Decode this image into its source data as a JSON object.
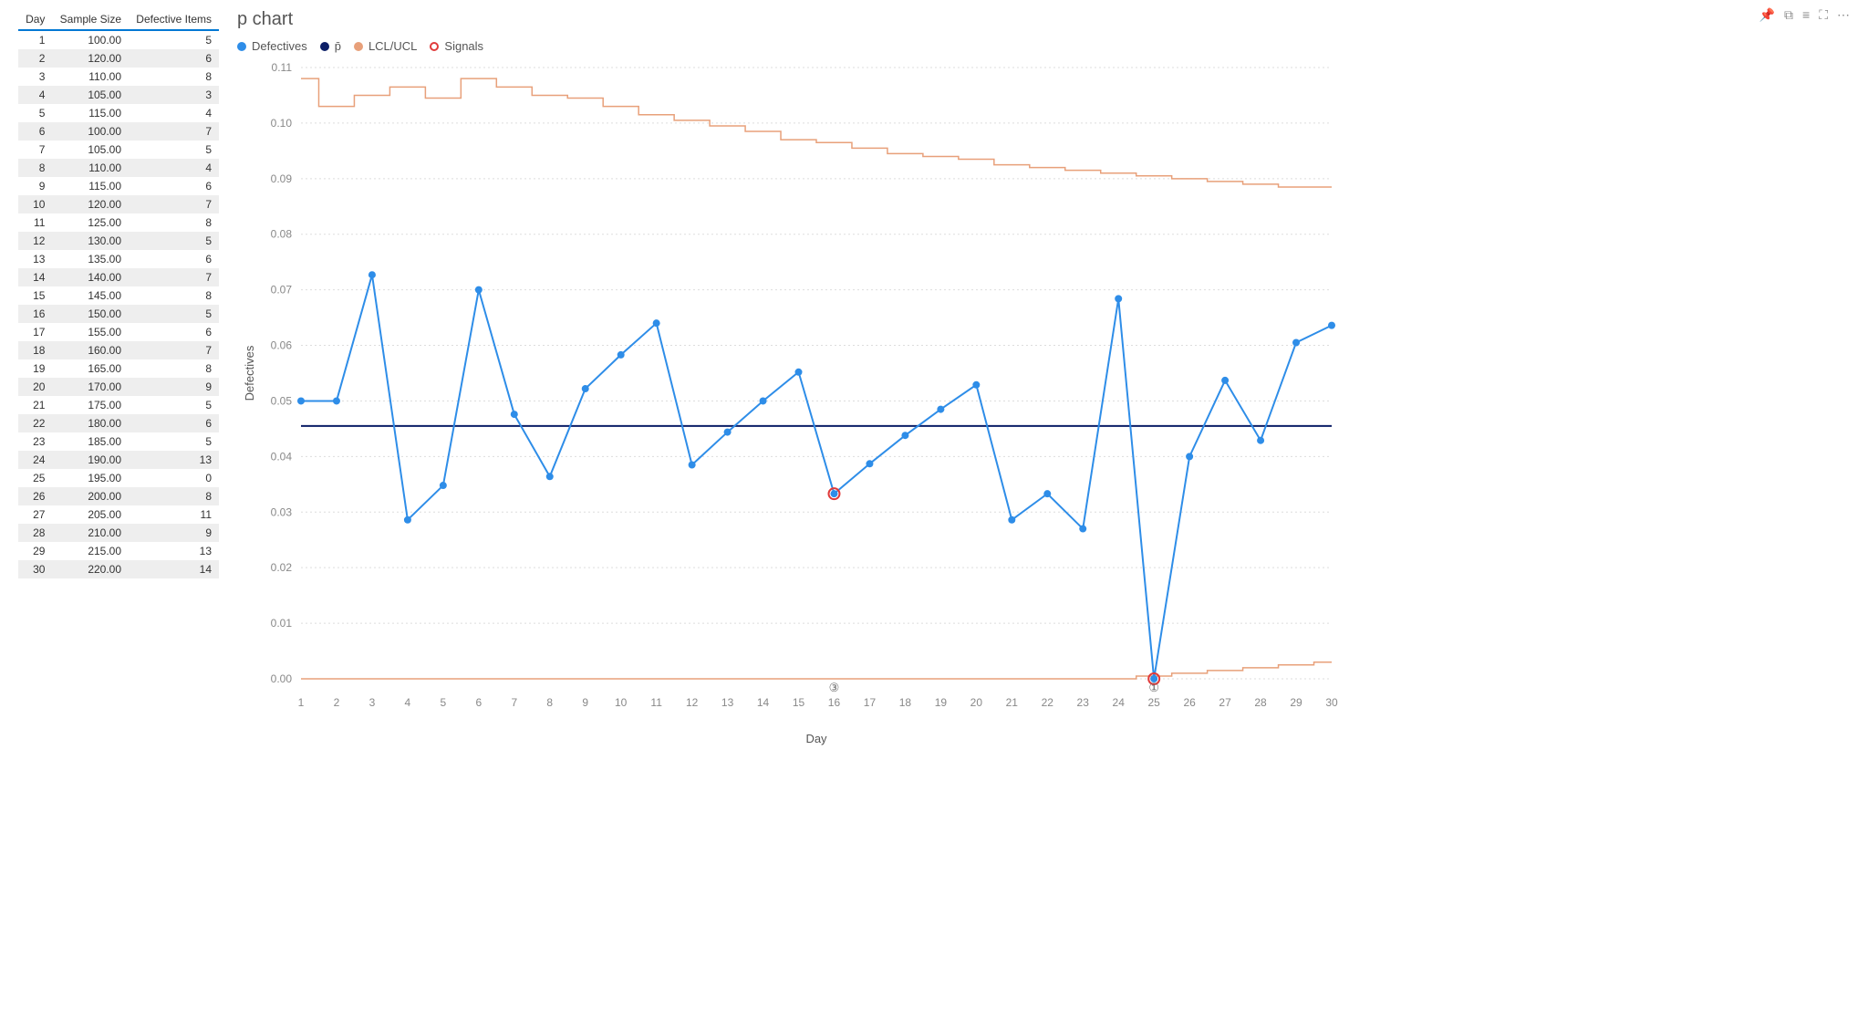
{
  "toolbar": {
    "pin": "📌",
    "copy": "⧉",
    "filter": "≡",
    "focus": "⛶",
    "more": "⋯"
  },
  "table": {
    "headers": [
      "Day",
      "Sample Size",
      "Defective Items"
    ],
    "rows": [
      {
        "day": 1,
        "size": "100.00",
        "def": 5
      },
      {
        "day": 2,
        "size": "120.00",
        "def": 6
      },
      {
        "day": 3,
        "size": "110.00",
        "def": 8
      },
      {
        "day": 4,
        "size": "105.00",
        "def": 3
      },
      {
        "day": 5,
        "size": "115.00",
        "def": 4
      },
      {
        "day": 6,
        "size": "100.00",
        "def": 7
      },
      {
        "day": 7,
        "size": "105.00",
        "def": 5
      },
      {
        "day": 8,
        "size": "110.00",
        "def": 4
      },
      {
        "day": 9,
        "size": "115.00",
        "def": 6
      },
      {
        "day": 10,
        "size": "120.00",
        "def": 7
      },
      {
        "day": 11,
        "size": "125.00",
        "def": 8
      },
      {
        "day": 12,
        "size": "130.00",
        "def": 5
      },
      {
        "day": 13,
        "size": "135.00",
        "def": 6
      },
      {
        "day": 14,
        "size": "140.00",
        "def": 7
      },
      {
        "day": 15,
        "size": "145.00",
        "def": 8
      },
      {
        "day": 16,
        "size": "150.00",
        "def": 5
      },
      {
        "day": 17,
        "size": "155.00",
        "def": 6
      },
      {
        "day": 18,
        "size": "160.00",
        "def": 7
      },
      {
        "day": 19,
        "size": "165.00",
        "def": 8
      },
      {
        "day": 20,
        "size": "170.00",
        "def": 9
      },
      {
        "day": 21,
        "size": "175.00",
        "def": 5
      },
      {
        "day": 22,
        "size": "180.00",
        "def": 6
      },
      {
        "day": 23,
        "size": "185.00",
        "def": 5
      },
      {
        "day": 24,
        "size": "190.00",
        "def": 13
      },
      {
        "day": 25,
        "size": "195.00",
        "def": 0
      },
      {
        "day": 26,
        "size": "200.00",
        "def": 8
      },
      {
        "day": 27,
        "size": "205.00",
        "def": 11
      },
      {
        "day": 28,
        "size": "210.00",
        "def": 9
      },
      {
        "day": 29,
        "size": "215.00",
        "def": 13
      },
      {
        "day": 30,
        "size": "220.00",
        "def": 14
      }
    ]
  },
  "chart_data": {
    "type": "line",
    "title": "p chart",
    "xlabel": "Day",
    "ylabel": "Defectives",
    "ylim": [
      0,
      0.11
    ],
    "yticks": [
      0.0,
      0.01,
      0.02,
      0.03,
      0.04,
      0.05,
      0.06,
      0.07,
      0.08,
      0.09,
      0.1,
      0.11
    ],
    "x": [
      1,
      2,
      3,
      4,
      5,
      6,
      7,
      8,
      9,
      10,
      11,
      12,
      13,
      14,
      15,
      16,
      17,
      18,
      19,
      20,
      21,
      22,
      23,
      24,
      25,
      26,
      27,
      28,
      29,
      30
    ],
    "legend": [
      {
        "name": "Defectives",
        "color": "#2E8DE8",
        "type": "dot"
      },
      {
        "name": "p̄",
        "color": "#0B1E66",
        "type": "dot"
      },
      {
        "name": "LCL/UCL",
        "color": "#E8A07A",
        "type": "dot"
      },
      {
        "name": "Signals",
        "color": "#E03B3B",
        "type": "ring"
      }
    ],
    "series": [
      {
        "name": "Defectives",
        "values": [
          0.05,
          0.05,
          0.0727,
          0.0286,
          0.0348,
          0.07,
          0.0476,
          0.0364,
          0.0522,
          0.0583,
          0.064,
          0.0385,
          0.0444,
          0.05,
          0.0552,
          0.0333,
          0.0387,
          0.0438,
          0.0485,
          0.0529,
          0.0286,
          0.0333,
          0.027,
          0.0684,
          0.0,
          0.04,
          0.0537,
          0.0429,
          0.0605,
          0.0636
        ]
      },
      {
        "name": "p̄",
        "values": [
          0.0455,
          0.0455,
          0.0455,
          0.0455,
          0.0455,
          0.0455,
          0.0455,
          0.0455,
          0.0455,
          0.0455,
          0.0455,
          0.0455,
          0.0455,
          0.0455,
          0.0455,
          0.0455,
          0.0455,
          0.0455,
          0.0455,
          0.0455,
          0.0455,
          0.0455,
          0.0455,
          0.0455,
          0.0455,
          0.0455,
          0.0455,
          0.0455,
          0.0455,
          0.0455
        ]
      },
      {
        "name": "UCL",
        "values": [
          0.108,
          0.103,
          0.105,
          0.1065,
          0.1045,
          0.108,
          0.1065,
          0.105,
          0.1045,
          0.103,
          0.1015,
          0.1005,
          0.0995,
          0.0985,
          0.097,
          0.0965,
          0.0955,
          0.0945,
          0.094,
          0.0935,
          0.0925,
          0.092,
          0.0915,
          0.091,
          0.0905,
          0.09,
          0.0895,
          0.089,
          0.0885,
          0.0885
        ]
      },
      {
        "name": "LCL",
        "values": [
          0,
          0,
          0,
          0,
          0,
          0,
          0,
          0,
          0,
          0,
          0,
          0,
          0,
          0,
          0,
          0,
          0,
          0,
          0,
          0,
          0,
          0,
          0,
          0,
          0.0005,
          0.001,
          0.0015,
          0.002,
          0.0025,
          0.003
        ]
      }
    ],
    "signals": [
      {
        "x": 16,
        "y": 0.0333,
        "label": "③"
      },
      {
        "x": 25,
        "y": 0.0,
        "label": "①"
      }
    ]
  }
}
